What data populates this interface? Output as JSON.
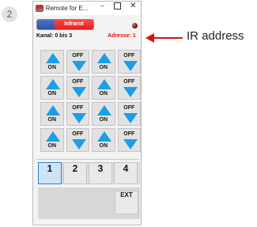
{
  "step_number": "2",
  "window": {
    "title": "Remote for E...",
    "controls": {
      "minimize": "–",
      "close": "✕"
    }
  },
  "toggle": {
    "label": "Infrarot",
    "state": "on"
  },
  "status_led_icon": "led-indicator-icon",
  "info": {
    "kanal": "Kanal: 0 bis 3",
    "adresse": "Adresse: 1"
  },
  "pad_rows": [
    {
      "on": "ON",
      "off": "OFF",
      "on2": "ON",
      "off2": "OFF"
    },
    {
      "on": "ON",
      "off": "OFF",
      "on2": "ON",
      "off2": "OFF"
    },
    {
      "on": "ON",
      "off": "OFF",
      "on2": "ON",
      "off2": "OFF"
    },
    {
      "on": "ON",
      "off": "OFF",
      "on2": "ON",
      "off2": "OFF"
    }
  ],
  "channels": [
    "1",
    "2",
    "3",
    "4"
  ],
  "active_channel": "1",
  "ext_label": "EXT",
  "callout": {
    "text": "IR address",
    "color": "#e01010"
  },
  "colors": {
    "arrow_blue": "#1b9ee6",
    "toggle_red": "#e81c1c",
    "toggle_blue": "#2b54a8",
    "adresse_red": "#e01010"
  }
}
